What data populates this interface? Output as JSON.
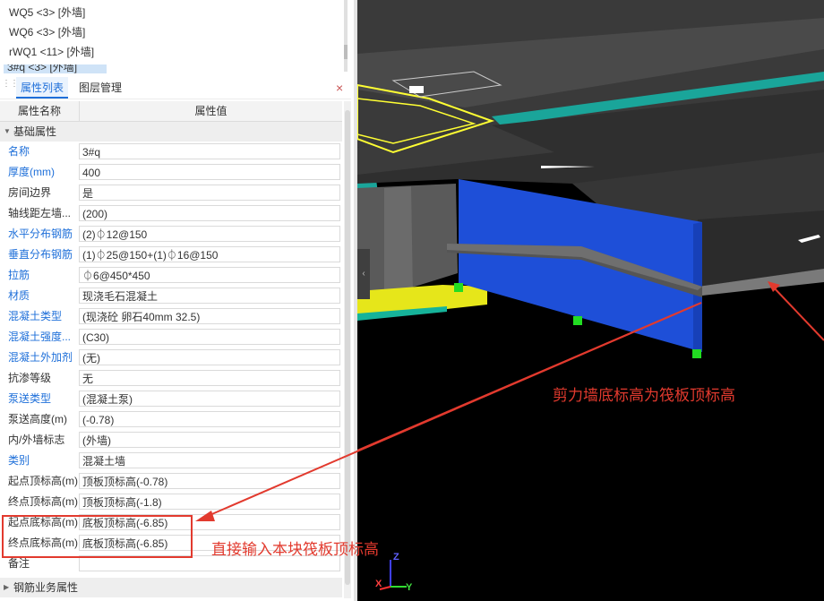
{
  "wall_list": {
    "items": [
      "WQ5 <3> [外墙]",
      "WQ6 <3> [外墙]",
      "rWQ1 <11> [外墙]"
    ],
    "selected": "3#q <3> [外墙]"
  },
  "tabs": [
    "属性列表",
    "图层管理"
  ],
  "close_icon": "×",
  "table_header": {
    "name": "属性名称",
    "value": "属性值"
  },
  "group_basic": "基础属性",
  "group_rebar": "钢筋业务属性",
  "properties": [
    {
      "name": "名称",
      "value": "3#q",
      "blue": true
    },
    {
      "name": "厚度(mm)",
      "value": "400",
      "blue": true
    },
    {
      "name": "房间边界",
      "value": "是",
      "blue": false
    },
    {
      "name": "轴线距左墙...",
      "value": "(200)",
      "blue": false
    },
    {
      "name": "水平分布钢筋",
      "value": "(2)⏀12@150",
      "blue": true
    },
    {
      "name": "垂直分布钢筋",
      "value": "(1)⏀25@150+(1)⏀16@150",
      "blue": true
    },
    {
      "name": "拉筋",
      "value": "⏀6@450*450",
      "blue": true
    },
    {
      "name": "材质",
      "value": "现浇毛石混凝土",
      "blue": true
    },
    {
      "name": "混凝土类型",
      "value": "(现浇砼 卵石40mm 32.5)",
      "blue": true
    },
    {
      "name": "混凝土强度...",
      "value": "(C30)",
      "blue": true
    },
    {
      "name": "混凝土外加剂",
      "value": "(无)",
      "blue": true
    },
    {
      "name": "抗渗等级",
      "value": "无",
      "blue": false
    },
    {
      "name": "泵送类型",
      "value": "(混凝土泵)",
      "blue": true
    },
    {
      "name": "泵送高度(m)",
      "value": "(-0.78)",
      "blue": false
    },
    {
      "name": "内/外墙标志",
      "value": "(外墙)",
      "blue": false
    },
    {
      "name": "类别",
      "value": "混凝土墙",
      "blue": true
    },
    {
      "name": "起点顶标高(m)",
      "value": "顶板顶标高(-0.78)",
      "blue": false
    },
    {
      "name": "终点顶标高(m)",
      "value": "顶板顶标高(-1.8)",
      "blue": false
    },
    {
      "name": "起点底标高(m)",
      "value": "底板顶标高(-6.85)",
      "blue": false
    },
    {
      "name": "终点底标高(m)",
      "value": "底板顶标高(-6.85)",
      "blue": false
    },
    {
      "name": "备注",
      "value": "",
      "blue": false
    }
  ],
  "annotations": {
    "scene_note": "剪力墙底标高为筏板顶标高",
    "input_note": "直接输入本块筏板顶标高"
  },
  "axis": {
    "z": "Z",
    "x": "X",
    "y": "Y"
  },
  "colors": {
    "accent": "#1e6fd9",
    "annotation": "#e23a2e",
    "wall": "#1e4fd8",
    "selection": "#ffff33",
    "marker": "#22dd22"
  }
}
